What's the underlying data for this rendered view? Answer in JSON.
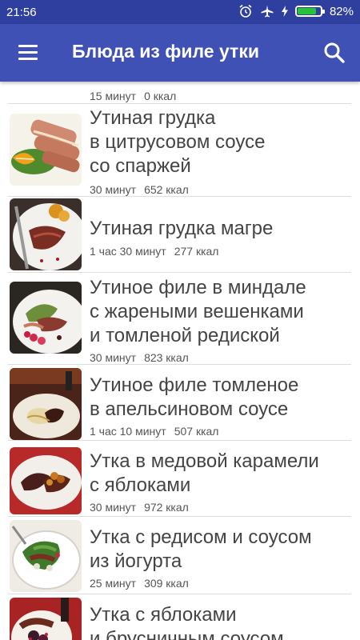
{
  "status_bar": {
    "time": "21:56",
    "battery_percent_label": "82%",
    "battery_level": 0.82
  },
  "app_bar": {
    "title": "Блюда из филе утки"
  },
  "list": {
    "partial_item": {
      "time": "15 минут",
      "calories": "0 ккал"
    },
    "items": [
      {
        "title_lines": [
          "Утиная грудка",
          "в цитрусовом соусе",
          "со спаржей"
        ],
        "time": "30 минут",
        "calories": "652 ккал"
      },
      {
        "title_lines": [
          "Утиная грудка магре"
        ],
        "time": "1 час 30 минут",
        "calories": "277 ккал"
      },
      {
        "title_lines": [
          "Утиное филе в миндале",
          "с жареными вешенками",
          "и томленой редиской"
        ],
        "time": "30 минут",
        "calories": "823 ккал"
      },
      {
        "title_lines": [
          "Утиное филе томленое",
          "в апельсиновом соусе"
        ],
        "time": "1 час 10 минут",
        "calories": "507 ккал"
      },
      {
        "title_lines": [
          "Утка в медовой карамели",
          "с яблоками"
        ],
        "time": "30 минут",
        "calories": "972 ккал"
      },
      {
        "title_lines": [
          "Утка с редисом и соусом",
          "из йогурта"
        ],
        "time": "25 минут",
        "calories": "309 ккал"
      },
      {
        "title_lines": [
          "Утка с яблоками",
          "и брусничным соусом"
        ],
        "time": "",
        "calories": ""
      }
    ]
  }
}
